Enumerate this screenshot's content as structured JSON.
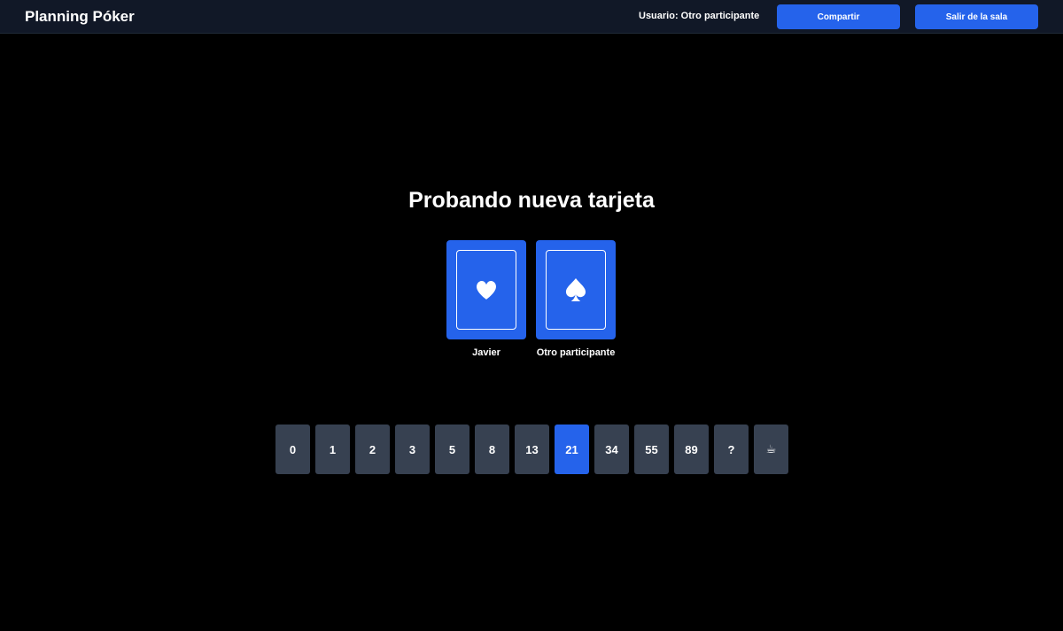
{
  "header": {
    "app_title": "Planning Póker",
    "user_label": "Usuario: Otro participante",
    "share_label": "Compartir",
    "leave_label": "Salir de la sala"
  },
  "story": {
    "title": "Probando nueva tarjeta"
  },
  "players": [
    {
      "name": "Javier",
      "suit_icon": "heart-icon"
    },
    {
      "name": "Otro participante",
      "suit_icon": "spade-icon"
    }
  ],
  "deck": {
    "cards": [
      "0",
      "1",
      "2",
      "3",
      "5",
      "8",
      "13",
      "21",
      "34",
      "55",
      "89",
      "?",
      "☕"
    ],
    "selected": "21"
  },
  "colors": {
    "accent": "#2563eb",
    "card_inactive": "#374151",
    "header_bg": "#111827",
    "page_bg": "#000000"
  }
}
